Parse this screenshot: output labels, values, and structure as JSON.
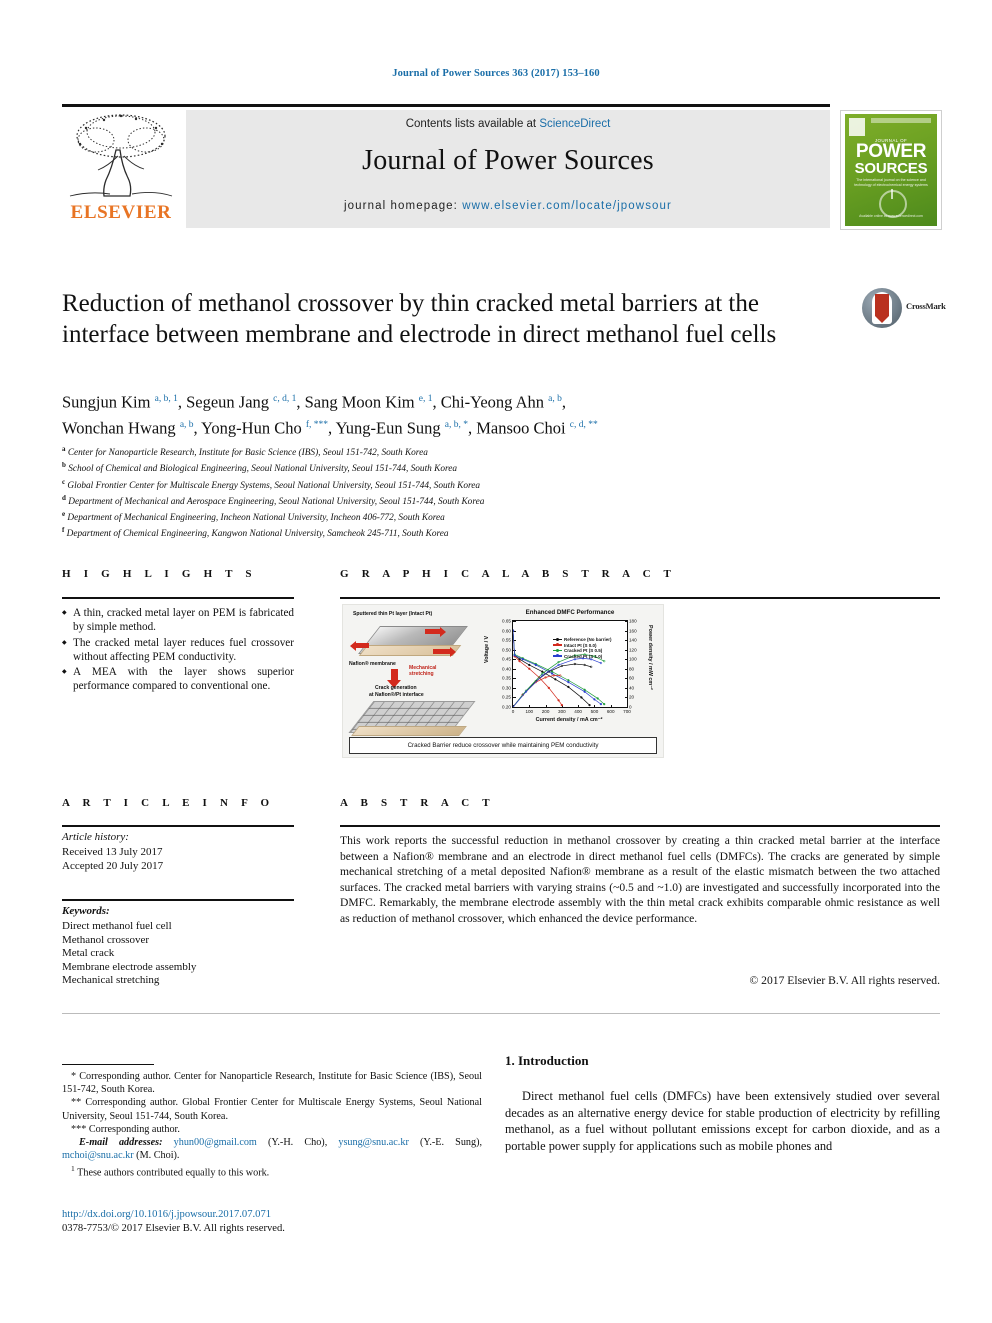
{
  "running_head": "Journal of Power Sources 363 (2017) 153–160",
  "masthead": {
    "contents_prefix": "Contents lists available at ",
    "contents_link": "ScienceDirect",
    "journal_name": "Journal of Power Sources",
    "homepage_prefix": "journal homepage: ",
    "homepage_url": "www.elsevier.com/locate/jpowsour",
    "publisher": "ELSEVIER",
    "cover": {
      "top_small": "JOURNAL OF",
      "power": "POWER",
      "sources": "SOURCES",
      "subtitle": "The international journal on the science and technology of electrochemical energy systems",
      "footer": "Available online at www.sciencedirect.com"
    }
  },
  "article": {
    "title": "Reduction of methanol crossover by thin cracked metal barriers at the interface between membrane and electrode in direct methanol fuel cells",
    "crossmark_label": "CrossMark",
    "authors_line1": "Sungjun Kim <sup>a, b, 1</sup>, Segeun Jang <sup>c, d, 1</sup>, Sang Moon Kim <sup>e, 1</sup>, Chi-Yeong Ahn <sup>a, b</sup>,",
    "authors_line2": "Wonchan Hwang <sup>a, b</sup>, Yong-Hun Cho <sup>f, ***</sup>, Yung-Eun Sung <sup>a, b, *</sup>, Mansoo Choi <sup>c, d, **</sup>",
    "affiliations": [
      {
        "label": "a",
        "text": "Center for Nanoparticle Research, Institute for Basic Science (IBS), Seoul 151-742, South Korea"
      },
      {
        "label": "b",
        "text": "School of Chemical and Biological Engineering, Seoul National University, Seoul 151-744, South Korea"
      },
      {
        "label": "c",
        "text": "Global Frontier Center for Multiscale Energy Systems, Seoul National University, Seoul 151-744, South Korea"
      },
      {
        "label": "d",
        "text": "Department of Mechanical and Aerospace Engineering, Seoul National University, Seoul 151-744, South Korea"
      },
      {
        "label": "e",
        "text": "Department of Mechanical Engineering, Incheon National University, Incheon 406-772, South Korea"
      },
      {
        "label": "f",
        "text": "Department of Chemical Engineering, Kangwon National University, Samcheok 245-711, South Korea"
      }
    ]
  },
  "highlights": {
    "heading": "H I G H L I G H T S",
    "items": [
      "A thin, cracked metal layer on PEM is fabricated by simple method.",
      "The cracked metal layer reduces fuel crossover without affecting PEM conductivity.",
      "A MEA with the layer shows superior performance compared to conventional one."
    ]
  },
  "graphical_abstract": {
    "heading": "G R A P H I C A L   A B S T R A C T",
    "diagram": {
      "label_top": "Sputtered thin Pt layer (Intact Pt)",
      "label_membrane": "Nafion® membrane",
      "label_stretch": "Mechanical stretching",
      "label_crack_line1": "Crack generation",
      "label_crack_line2": "at Nafion®/Pt interface"
    },
    "caption": "Cracked Barrier reduce crossover while maintaining PEM conductivity"
  },
  "chart_data": {
    "type": "line",
    "title": "Enhanced DMFC Performance",
    "xlabel": "Current density / mA cm⁻²",
    "ylabel": "Voltage / V",
    "y2label": "Power density / mW cm⁻²",
    "xlim": [
      0,
      700
    ],
    "ylim": [
      0.2,
      0.65
    ],
    "y2lim": [
      0,
      180
    ],
    "xticks": [
      0,
      100,
      200,
      300,
      400,
      500,
      600,
      700
    ],
    "yticks": [
      "0.65",
      "0.60",
      "0.55",
      "0.50",
      "0.45",
      "0.40",
      "0.35",
      "0.30",
      "0.25",
      "0.20"
    ],
    "y2ticks": [
      180,
      160,
      140,
      120,
      100,
      80,
      60,
      40,
      20,
      0
    ],
    "grid": false,
    "legend_position": "top-left",
    "legend": [
      {
        "name": "Reference (No barrier)",
        "color": "#111111"
      },
      {
        "name": "Intact Pt (S 0.0)",
        "color": "#d32a1d"
      },
      {
        "name": "Cracked Pt (S 0.5)",
        "color": "#1f9e3a"
      },
      {
        "name": "Cracked Pt (S 1.0)",
        "color": "#2a3fd0"
      }
    ],
    "series": [
      {
        "name": "Reference (No barrier) - polarization",
        "axis": "left",
        "color": "#111111",
        "x": [
          0,
          10,
          40,
          100,
          180,
          260,
          340,
          420,
          470
        ],
        "y": [
          0.6,
          0.47,
          0.45,
          0.42,
          0.385,
          0.345,
          0.305,
          0.25,
          0.21
        ]
      },
      {
        "name": "Intact Pt (S 0.0) - polarization",
        "axis": "left",
        "color": "#d32a1d",
        "x": [
          0,
          10,
          40,
          100,
          160,
          220,
          280,
          300
        ],
        "y": [
          0.6,
          0.465,
          0.44,
          0.4,
          0.355,
          0.3,
          0.235,
          0.21
        ]
      },
      {
        "name": "Cracked Pt (S 0.5) - polarization",
        "axis": "left",
        "color": "#1f9e3a",
        "x": [
          0,
          10,
          60,
          140,
          240,
          340,
          440,
          520,
          560
        ],
        "y": [
          0.6,
          0.475,
          0.455,
          0.425,
          0.385,
          0.34,
          0.29,
          0.245,
          0.215
        ]
      },
      {
        "name": "Cracked Pt (S 1.0) - polarization",
        "axis": "left",
        "color": "#2a3fd0",
        "x": [
          0,
          10,
          60,
          140,
          240,
          340,
          440,
          500,
          540
        ],
        "y": [
          0.6,
          0.47,
          0.45,
          0.42,
          0.375,
          0.33,
          0.28,
          0.24,
          0.215
        ]
      },
      {
        "name": "Reference (No barrier) - power",
        "axis": "right",
        "color": "#111111",
        "x": [
          0,
          60,
          140,
          220,
          300,
          380,
          440,
          480
        ],
        "y": [
          0,
          26,
          54,
          74,
          86,
          90,
          88,
          84
        ]
      },
      {
        "name": "Intact Pt (S 0.0) - power",
        "axis": "right",
        "color": "#d32a1d",
        "x": [
          0,
          60,
          140,
          200,
          250,
          290
        ],
        "y": [
          0,
          25,
          52,
          62,
          66,
          66
        ]
      },
      {
        "name": "Cracked Pt (S 0.5) - power",
        "axis": "right",
        "color": "#1f9e3a",
        "x": [
          0,
          80,
          180,
          280,
          380,
          440,
          500,
          560
        ],
        "y": [
          0,
          34,
          70,
          94,
          108,
          110,
          106,
          96
        ]
      },
      {
        "name": "Cracked Pt (S 1.0) - power",
        "axis": "right",
        "color": "#2a3fd0",
        "x": [
          0,
          80,
          180,
          280,
          380,
          430,
          480,
          540
        ],
        "y": [
          0,
          32,
          66,
          88,
          100,
          102,
          100,
          92
        ]
      }
    ]
  },
  "article_info": {
    "heading": "A R T I C L E   I N F O",
    "history_label": "Article history:",
    "received": "Received 13 July 2017",
    "accepted": "Accepted 20 July 2017",
    "keywords_label": "Keywords:",
    "keywords": [
      "Direct methanol fuel cell",
      "Methanol crossover",
      "Metal crack",
      "Membrane electrode assembly",
      "Mechanical stretching"
    ]
  },
  "abstract": {
    "heading": "A B S T R A C T",
    "body": "This work reports the successful reduction in methanol crossover by creating a thin cracked metal barrier at the interface between a Nafion® membrane and an electrode in direct methanol fuel cells (DMFCs). The cracks are generated by simple mechanical stretching of a metal deposited Nafion® membrane as a result of the elastic mismatch between the two attached surfaces. The cracked metal barriers with varying strains (~0.5 and ~1.0) are investigated and successfully incorporated into the DMFC. Remarkably, the membrane electrode assembly with the thin metal crack exhibits comparable ohmic resistance as well as reduction of methanol crossover, which enhanced the device performance.",
    "copyright": "© 2017 Elsevier B.V. All rights reserved."
  },
  "footnotes": {
    "corr1": "* Corresponding author. Center for Nanoparticle Research, Institute for Basic Science (IBS), Seoul 151-742, South Korea.",
    "corr2": "** Corresponding author. Global Frontier Center for Multiscale Energy Systems, Seoul National University, Seoul 151-744, South Korea.",
    "corr3": "*** Corresponding author.",
    "email_label": "E-mail addresses:",
    "email1": "yhun00@gmail.com",
    "email1_name": "(Y.-H. Cho),",
    "email2": "ysung@snu.ac.kr",
    "email2_name": "(Y.-E. Sung),",
    "email3": "mchoi@snu.ac.kr",
    "email3_name": "(M. Choi).",
    "equal_contrib": "These authors contributed equally to this work.",
    "equal_marker": "1"
  },
  "footer": {
    "doi": "http://dx.doi.org/10.1016/j.jpowsour.2017.07.071",
    "issn": "0378-7753/© 2017 Elsevier B.V. All rights reserved."
  },
  "introduction": {
    "heading": "1. Introduction",
    "paragraph": "Direct methanol fuel cells (DMFCs) have been extensively studied over several decades as an alternative energy device for stable production of electricity by refilling methanol, as a fuel without pollutant emissions except for carbon dioxide, and as a portable power supply for applications such as mobile phones and"
  }
}
